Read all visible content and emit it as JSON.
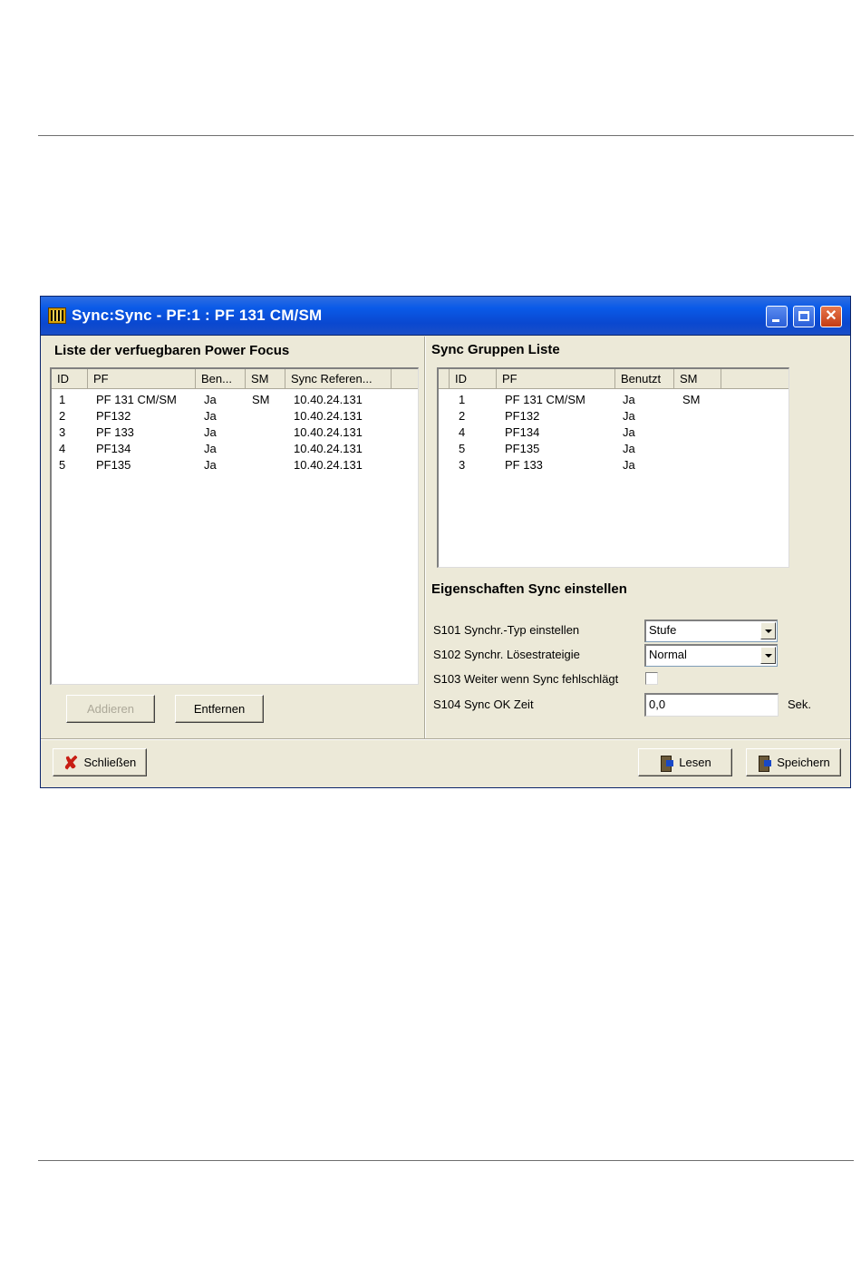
{
  "window": {
    "title": "Sync:Sync - PF:1 : PF 131 CM/SM"
  },
  "left_panel": {
    "heading": "Liste der verfuegbaren Power Focus",
    "columns": [
      "ID",
      "PF",
      "Ben...",
      "SM",
      "Sync Referen..."
    ],
    "rows": [
      {
        "id": "1",
        "pf": "PF 131 CM/SM",
        "ben": "Ja",
        "sm": "SM",
        "ref": "10.40.24.131"
      },
      {
        "id": "2",
        "pf": "PF132",
        "ben": "Ja",
        "sm": "",
        "ref": "10.40.24.131"
      },
      {
        "id": "3",
        "pf": "PF 133",
        "ben": "Ja",
        "sm": "",
        "ref": "10.40.24.131"
      },
      {
        "id": "4",
        "pf": "PF134",
        "ben": "Ja",
        "sm": "",
        "ref": "10.40.24.131"
      },
      {
        "id": "5",
        "pf": "PF135",
        "ben": "Ja",
        "sm": "",
        "ref": "10.40.24.131"
      }
    ],
    "add_label": "Addieren",
    "remove_label": "Entfernen"
  },
  "right_panel": {
    "heading": "Sync Gruppen Liste",
    "columns": [
      "ID",
      "PF",
      "Benutzt",
      "SM"
    ],
    "rows": [
      {
        "id": "1",
        "pf": "PF 131 CM/SM",
        "ben": "Ja",
        "sm": "SM"
      },
      {
        "id": "2",
        "pf": "PF132",
        "ben": "Ja",
        "sm": ""
      },
      {
        "id": "4",
        "pf": "PF134",
        "ben": "Ja",
        "sm": ""
      },
      {
        "id": "5",
        "pf": "PF135",
        "ben": "Ja",
        "sm": ""
      },
      {
        "id": "3",
        "pf": "PF 133",
        "ben": "Ja",
        "sm": ""
      }
    ],
    "props_heading": "Eigenschaften Sync einstellen",
    "s101_label": "S101 Synchr.-Typ einstellen",
    "s101_value": "Stufe",
    "s102_label": "S102 Synchr. Lösestrateigie",
    "s102_value": "Normal",
    "s103_label": "S103 Weiter wenn Sync fehlschlägt",
    "s104_label": "S104 Sync OK Zeit",
    "s104_value": "0,0",
    "s104_unit": "Sek."
  },
  "footer": {
    "close_label": "Schließen",
    "read_label": "Lesen",
    "save_label": "Speichern"
  }
}
